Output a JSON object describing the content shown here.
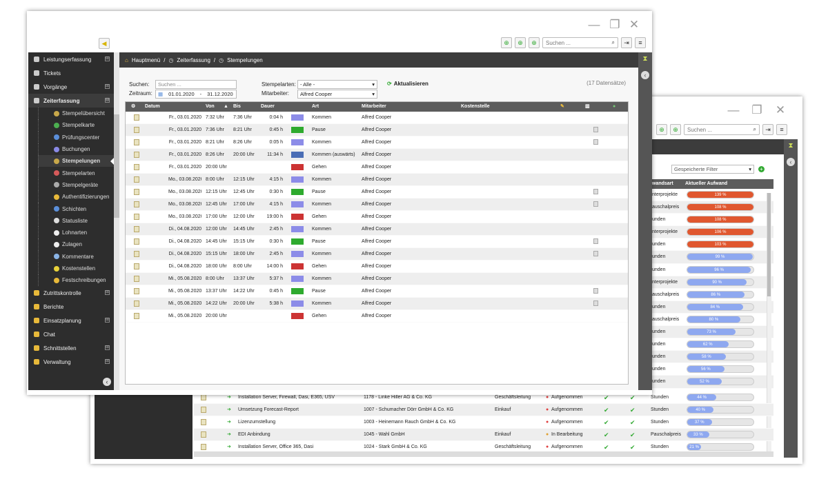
{
  "front": {
    "search_placeholder": "Suchen ...",
    "sidebar": {
      "items_top": [
        {
          "label": "Leistungserfassung",
          "icon": "hourglass-icon",
          "expand": "⊞"
        },
        {
          "label": "Tickets",
          "icon": "tag-icon",
          "expand": ""
        },
        {
          "label": "Vorgänge",
          "icon": "folder-icon",
          "expand": "⊞"
        },
        {
          "label": "Zeiterfassung",
          "icon": "clock-icon",
          "expand": "⊟",
          "active": true
        }
      ],
      "sub_items": [
        {
          "label": "Stempelübersicht",
          "color": "#c8a84a"
        },
        {
          "label": "Stempelkarte",
          "color": "#4caf50"
        },
        {
          "label": "Prüfungscenter",
          "color": "#5b8fd9"
        },
        {
          "label": "Buchungen",
          "color": "#8a8ae6"
        },
        {
          "label": "Stempelungen",
          "color": "#c8a84a",
          "active": true
        },
        {
          "label": "Stempelarten",
          "color": "#d65a5a"
        },
        {
          "label": "Stempelgeräte",
          "color": "#aaaaaa"
        },
        {
          "label": "Authentifizierungen",
          "color": "#e8b93a"
        },
        {
          "label": "Schichten",
          "color": "#5b8fd9"
        },
        {
          "label": "Statusliste",
          "color": "#dddddd"
        },
        {
          "label": "Lohnarten",
          "color": "#eeeeee"
        },
        {
          "label": "Zulagen",
          "color": "#eeeeee"
        },
        {
          "label": "Kommentare",
          "color": "#8ab4e6"
        },
        {
          "label": "Kostenstellen",
          "color": "#e8d13a"
        },
        {
          "label": "Festschreibungen",
          "color": "#e8b93a"
        }
      ],
      "items_bottom": [
        {
          "label": "Zutrittskontrolle",
          "icon": "lock-icon",
          "expand": "⊞"
        },
        {
          "label": "Berichte",
          "icon": "report-icon",
          "expand": ""
        },
        {
          "label": "Einsatzplanung",
          "icon": "calendar-icon",
          "expand": "⊞"
        },
        {
          "label": "Chat",
          "icon": "chat-icon",
          "expand": ""
        },
        {
          "label": "Schnittstellen",
          "icon": "plug-icon",
          "expand": "⊞"
        },
        {
          "label": "Verwaltung",
          "icon": "gear-icon",
          "expand": "⊞"
        }
      ]
    },
    "breadcrumb": [
      "Hauptmenü",
      "/",
      "Zeiterfassung",
      "/",
      "Stempelungen"
    ],
    "filters": {
      "suchen_label": "Suchen:",
      "suchen_placeholder": "Suchen ...",
      "zeitraum_label": "Zeitraum:",
      "date_from": "01.01.2020",
      "date_sep": "-",
      "date_to": "31.12.2020",
      "stempelarten_label": "Stempelarten:",
      "stempelarten_value": "- Alle -",
      "mitarbeiter_label": "Mitarbeiter:",
      "mitarbeiter_value": "Alfred Cooper",
      "refresh_label": "Aktualisieren",
      "record_count": "(17 Datensätze)"
    },
    "table": {
      "headers": {
        "datum": "Datum",
        "von": "Von",
        "bis": "Bis",
        "dauer": "Dauer",
        "art": "Art",
        "mitarbeiter": "Mitarbeiter",
        "kostenstelle": "Kostenstelle"
      },
      "rows": [
        {
          "datum": "Fr., 03.01.2020",
          "von": "7:32 Uhr",
          "bis": "7:36 Uhr",
          "dauer": "0:04 h",
          "color": "#8c8ce8",
          "art": "Kommen",
          "mitarbeiter": "Alfred Cooper",
          "doc": false
        },
        {
          "datum": "Fr., 03.01.2020",
          "von": "7:36 Uhr",
          "bis": "8:21 Uhr",
          "dauer": "0:45 h",
          "color": "#2eaa2e",
          "art": "Pause",
          "mitarbeiter": "Alfred Cooper",
          "doc": true
        },
        {
          "datum": "Fr., 03.01.2020",
          "von": "8:21 Uhr",
          "bis": "8:26 Uhr",
          "dauer": "0:05 h",
          "color": "#8c8ce8",
          "art": "Kommen",
          "mitarbeiter": "Alfred Cooper",
          "doc": true
        },
        {
          "datum": "Fr., 03.01.2020",
          "von": "8:26 Uhr",
          "bis": "20:00 Uhr",
          "dauer": "11:34 h",
          "color": "#4a6db5",
          "art": "Kommen (auswärts)",
          "mitarbeiter": "Alfred Cooper",
          "doc": false
        },
        {
          "datum": "Fr., 03.01.2020",
          "von": "20:00 Uhr",
          "bis": "",
          "dauer": "",
          "color": "#cc3333",
          "art": "Gehen",
          "mitarbeiter": "Alfred Cooper",
          "doc": false
        },
        {
          "datum": "Mo., 03.08.2020",
          "von": "8:00 Uhr",
          "bis": "12:15 Uhr",
          "dauer": "4:15 h",
          "color": "#8c8ce8",
          "art": "Kommen",
          "mitarbeiter": "Alfred Cooper",
          "doc": false
        },
        {
          "datum": "Mo., 03.08.2020",
          "von": "12:15 Uhr",
          "bis": "12:45 Uhr",
          "dauer": "0:30 h",
          "color": "#2eaa2e",
          "art": "Pause",
          "mitarbeiter": "Alfred Cooper",
          "doc": true
        },
        {
          "datum": "Mo., 03.08.2020",
          "von": "12:45 Uhr",
          "bis": "17:00 Uhr",
          "dauer": "4:15 h",
          "color": "#8c8ce8",
          "art": "Kommen",
          "mitarbeiter": "Alfred Cooper",
          "doc": true
        },
        {
          "datum": "Mo., 03.08.2020",
          "von": "17:00 Uhr",
          "bis": "12:00 Uhr",
          "dauer": "19:00 h",
          "color": "#cc3333",
          "art": "Gehen",
          "mitarbeiter": "Alfred Cooper",
          "doc": false
        },
        {
          "datum": "Di., 04.08.2020",
          "von": "12:00 Uhr",
          "bis": "14:45 Uhr",
          "dauer": "2:45 h",
          "color": "#8c8ce8",
          "art": "Kommen",
          "mitarbeiter": "Alfred Cooper",
          "doc": false
        },
        {
          "datum": "Di., 04.08.2020",
          "von": "14:45 Uhr",
          "bis": "15:15 Uhr",
          "dauer": "0:30 h",
          "color": "#2eaa2e",
          "art": "Pause",
          "mitarbeiter": "Alfred Cooper",
          "doc": true
        },
        {
          "datum": "Di., 04.08.2020",
          "von": "15:15 Uhr",
          "bis": "18:00 Uhr",
          "dauer": "2:45 h",
          "color": "#8c8ce8",
          "art": "Kommen",
          "mitarbeiter": "Alfred Cooper",
          "doc": true
        },
        {
          "datum": "Di., 04.08.2020",
          "von": "18:00 Uhr",
          "bis": "8:00 Uhr",
          "dauer": "14:00 h",
          "color": "#cc3333",
          "art": "Gehen",
          "mitarbeiter": "Alfred Cooper",
          "doc": false
        },
        {
          "datum": "Mi., 05.08.2020",
          "von": "8:00 Uhr",
          "bis": "13:37 Uhr",
          "dauer": "5:37 h",
          "color": "#8c8ce8",
          "art": "Kommen",
          "mitarbeiter": "Alfred Cooper",
          "doc": false
        },
        {
          "datum": "Mi., 05.08.2020",
          "von": "13:37 Uhr",
          "bis": "14:22 Uhr",
          "dauer": "0:45 h",
          "color": "#2eaa2e",
          "art": "Pause",
          "mitarbeiter": "Alfred Cooper",
          "doc": true
        },
        {
          "datum": "Mi., 05.08.2020",
          "von": "14:22 Uhr",
          "bis": "20:00 Uhr",
          "dauer": "5:38 h",
          "color": "#8c8ce8",
          "art": "Kommen",
          "mitarbeiter": "Alfred Cooper",
          "doc": true
        },
        {
          "datum": "Mi., 05.08.2020",
          "von": "20:00 Uhr",
          "bis": "",
          "dauer": "",
          "color": "#cc3333",
          "art": "Gehen",
          "mitarbeiter": "Alfred Cooper",
          "doc": false
        }
      ]
    }
  },
  "back": {
    "search_placeholder": "Suchen ...",
    "filter_placeholder": "Gespeicherte Filter",
    "headers": {
      "aufwandsart": "wandsart",
      "aufwand": "Aktueller Aufwand"
    },
    "right_rows": [
      {
        "type": "nterprojekte",
        "pct": 1.39,
        "label": "139 %"
      },
      {
        "type": "auschalpreis",
        "pct": 1.08,
        "label": "108 %"
      },
      {
        "type": "unden",
        "pct": 1.08,
        "label": "108 %"
      },
      {
        "type": "nterprojekte",
        "pct": 1.06,
        "label": "106 %"
      },
      {
        "type": "unden",
        "pct": 1.03,
        "label": "103 %"
      },
      {
        "type": "unden",
        "pct": 0.99,
        "label": "99 %"
      },
      {
        "type": "unden",
        "pct": 0.96,
        "label": "96 %"
      },
      {
        "type": "nterprojekte",
        "pct": 0.9,
        "label": "90 %"
      },
      {
        "type": "auschalpreis",
        "pct": 0.86,
        "label": "86 %"
      },
      {
        "type": "unden",
        "pct": 0.84,
        "label": "84 %"
      },
      {
        "type": "auschalpreis",
        "pct": 0.8,
        "label": "80 %"
      },
      {
        "type": "unden",
        "pct": 0.73,
        "label": "73 %"
      },
      {
        "type": "unden",
        "pct": 0.62,
        "label": "62 %"
      },
      {
        "type": "unden",
        "pct": 0.58,
        "label": "58 %"
      },
      {
        "type": "unden",
        "pct": 0.56,
        "label": "56 %"
      },
      {
        "type": "unden",
        "pct": 0.52,
        "label": "52 %"
      }
    ],
    "bottom_rows": [
      {
        "name": "Installation Server, Firewall, Dasi, E365, USV",
        "customer": "1178 - Linke Hiller AG & Co. KG",
        "dept": "Geschäftsleitung",
        "status": "Aufgenommen",
        "status_color": "#e04040",
        "type": "Stunden",
        "pct": 0.44,
        "label": "44 %"
      },
      {
        "name": "Umsetzung Forecast-Report",
        "customer": "1007 - Schumacher Dörr GmbH & Co. KG",
        "dept": "Einkauf",
        "status": "Aufgenommen",
        "status_color": "#e04040",
        "type": "Stunden",
        "pct": 0.4,
        "label": "40 %"
      },
      {
        "name": "Lizenzumstellung",
        "customer": "1003 - Heinemann Rauch GmbH & Co. KG",
        "dept": "",
        "status": "Aufgenommen",
        "status_color": "#e04040",
        "type": "Stunden",
        "pct": 0.37,
        "label": "37 %"
      },
      {
        "name": "EDI Anbindung",
        "customer": "1045 - Wahl GmbH",
        "dept": "Einkauf",
        "status": "In Bearbeitung",
        "status_color": "#e0a030",
        "type": "Pauschalpreis",
        "pct": 0.33,
        "label": "33 %"
      },
      {
        "name": "Installation Server, Office 365, Dasi",
        "customer": "1024 - Stark GmbH & Co. KG",
        "dept": "Geschäftsleitung",
        "status": "Aufgenommen",
        "status_color": "#e04040",
        "type": "Stunden",
        "pct": 0.21,
        "label": "21 %"
      }
    ]
  }
}
